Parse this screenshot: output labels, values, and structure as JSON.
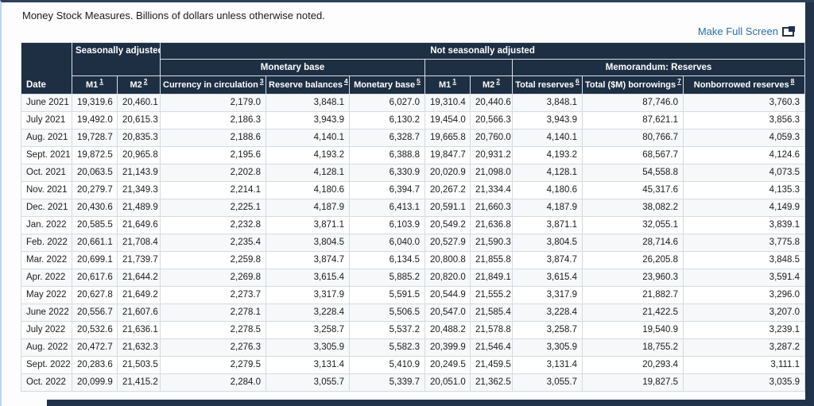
{
  "page": {
    "title": "Money Stock Measures. Billions of dollars unless otherwise noted.",
    "make_full_screen": "Make Full Screen"
  },
  "colors": {
    "header_bg": "#1e2f44",
    "frame_dark": "#20334a",
    "link_blue": "#2e6da4",
    "grid_line": "#d4dbe4"
  },
  "table": {
    "groups": {
      "seasonally_adjusted": "Seasonally adjusted",
      "not_seasonally_adjusted": "Not seasonally adjusted",
      "monetary_base": "Monetary base",
      "memorandum_reserves": "Memorandum: Reserves"
    },
    "columns": [
      {
        "label": "Date",
        "footnote": ""
      },
      {
        "label": "M1",
        "footnote": "1"
      },
      {
        "label": "M2",
        "footnote": "2"
      },
      {
        "label": "Currency in circulation",
        "footnote": "3"
      },
      {
        "label": "Reserve balances",
        "footnote": "4"
      },
      {
        "label": "Monetary base",
        "footnote": "5"
      },
      {
        "label": "M1",
        "footnote": "1"
      },
      {
        "label": "M2",
        "footnote": "2"
      },
      {
        "label": "Total reserves",
        "footnote": "6"
      },
      {
        "label": "Total ($M) borrowings",
        "footnote": "7"
      },
      {
        "label": "Nonborrowed reserves",
        "footnote": "8"
      }
    ],
    "rows": [
      [
        "June 2021",
        "19,319.6",
        "20,460.1",
        "2,179.0",
        "3,848.1",
        "6,027.0",
        "19,310.4",
        "20,440.6",
        "3,848.1",
        "87,746.0",
        "3,760.3"
      ],
      [
        "July 2021",
        "19,492.0",
        "20,615.3",
        "2,186.3",
        "3,943.9",
        "6,130.2",
        "19,454.0",
        "20,566.3",
        "3,943.9",
        "87,621.1",
        "3,856.3"
      ],
      [
        "Aug. 2021",
        "19,728.7",
        "20,835.3",
        "2,188.6",
        "4,140.1",
        "6,328.7",
        "19,665.8",
        "20,760.0",
        "4,140.1",
        "80,766.7",
        "4,059.3"
      ],
      [
        "Sept. 2021",
        "19,872.5",
        "20,965.8",
        "2,195.6",
        "4,193.2",
        "6,388.8",
        "19,847.7",
        "20,931.2",
        "4,193.2",
        "68,567.7",
        "4,124.6"
      ],
      [
        "Oct. 2021",
        "20,063.5",
        "21,143.9",
        "2,202.8",
        "4,128.1",
        "6,330.9",
        "20,020.9",
        "21,098.0",
        "4,128.1",
        "54,558.8",
        "4,073.5"
      ],
      [
        "Nov. 2021",
        "20,279.7",
        "21,349.3",
        "2,214.1",
        "4,180.6",
        "6,394.7",
        "20,267.2",
        "21,334.4",
        "4,180.6",
        "45,317.6",
        "4,135.3"
      ],
      [
        "Dec. 2021",
        "20,430.6",
        "21,489.9",
        "2,225.1",
        "4,187.9",
        "6,413.1",
        "20,591.1",
        "21,660.3",
        "4,187.9",
        "38,082.2",
        "4,149.9"
      ],
      [
        "Jan. 2022",
        "20,585.5",
        "21,649.6",
        "2,232.8",
        "3,871.1",
        "6,103.9",
        "20,549.2",
        "21,636.8",
        "3,871.1",
        "32,055.1",
        "3,839.1"
      ],
      [
        "Feb. 2022",
        "20,661.1",
        "21,708.4",
        "2,235.4",
        "3,804.5",
        "6,040.0",
        "20,527.9",
        "21,590.3",
        "3,804.5",
        "28,714.6",
        "3,775.8"
      ],
      [
        "Mar. 2022",
        "20,699.1",
        "21,739.7",
        "2,259.8",
        "3,874.7",
        "6,134.5",
        "20,800.8",
        "21,855.8",
        "3,874.7",
        "26,205.8",
        "3,848.5"
      ],
      [
        "Apr. 2022",
        "20,617.6",
        "21,644.2",
        "2,269.8",
        "3,615.4",
        "5,885.2",
        "20,820.0",
        "21,849.1",
        "3,615.4",
        "23,960.3",
        "3,591.4"
      ],
      [
        "May 2022",
        "20,627.8",
        "21,649.2",
        "2,273.7",
        "3,317.9",
        "5,591.5",
        "20,544.9",
        "21,555.2",
        "3,317.9",
        "21,882.7",
        "3,296.0"
      ],
      [
        "June 2022",
        "20,556.7",
        "21,607.6",
        "2,278.1",
        "3,228.4",
        "5,506.5",
        "20,547.0",
        "21,585.4",
        "3,228.4",
        "21,422.5",
        "3,207.0"
      ],
      [
        "July 2022",
        "20,532.6",
        "21,636.1",
        "2,278.5",
        "3,258.7",
        "5,537.2",
        "20,488.2",
        "21,578.8",
        "3,258.7",
        "19,540.9",
        "3,239.1"
      ],
      [
        "Aug. 2022",
        "20,472.7",
        "21,632.3",
        "2,276.3",
        "3,305.9",
        "5,582.3",
        "20,399.9",
        "21,546.4",
        "3,305.9",
        "18,755.2",
        "3,287.2"
      ],
      [
        "Sept. 2022",
        "20,283.6",
        "21,503.5",
        "2,279.5",
        "3,131.4",
        "5,410.9",
        "20,249.5",
        "21,459.5",
        "3,131.4",
        "20,293.4",
        "3,111.1"
      ],
      [
        "Oct. 2022",
        "20,099.9",
        "21,415.2",
        "2,284.0",
        "3,055.7",
        "5,339.7",
        "20,051.0",
        "21,362.5",
        "3,055.7",
        "19,827.5",
        "3,035.9"
      ]
    ]
  }
}
